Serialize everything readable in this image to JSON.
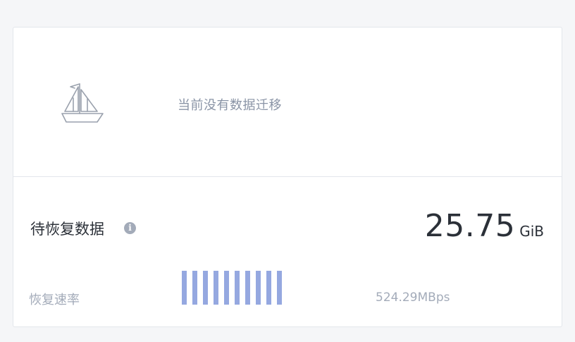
{
  "migration": {
    "empty_message": "当前没有数据迁移",
    "icon": "sailboat-icon"
  },
  "recovery": {
    "title": "待恢复数据",
    "info_icon": "info-icon",
    "info_glyph": "i",
    "value": "25.75",
    "unit": "GiB"
  },
  "rate": {
    "label": "恢复速率",
    "value": "524.29MBps",
    "bar_count": 10,
    "bar_color": "#95a8e0"
  }
}
